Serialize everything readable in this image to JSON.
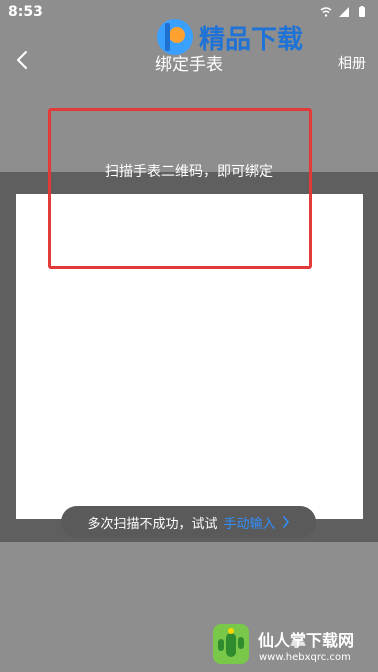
{
  "status_bar": {
    "time": "8:53",
    "icons": [
      "wifi-icon",
      "signal-icon",
      "battery-icon"
    ]
  },
  "header": {
    "back_icon": "chevron-left-icon",
    "title": "绑定手表",
    "album_label": "相册"
  },
  "scanner": {
    "hint": "扫描手表二维码，即可绑定"
  },
  "bottom_prompt": {
    "text": "多次扫描不成功，试试",
    "link": "手动输入",
    "link_icon": "chevron-right-icon"
  },
  "watermarks": {
    "top": {
      "title": "精品下载"
    },
    "bottom": {
      "title": "仙人掌下载网",
      "url": "www.hebxqrc.com"
    }
  },
  "colors": {
    "top_bg": "#8e8e8e",
    "band_bg": "#5f5f5f",
    "frame_bg": "#ffffff",
    "red_box": "#e23a3a",
    "link": "#2f8fff"
  }
}
